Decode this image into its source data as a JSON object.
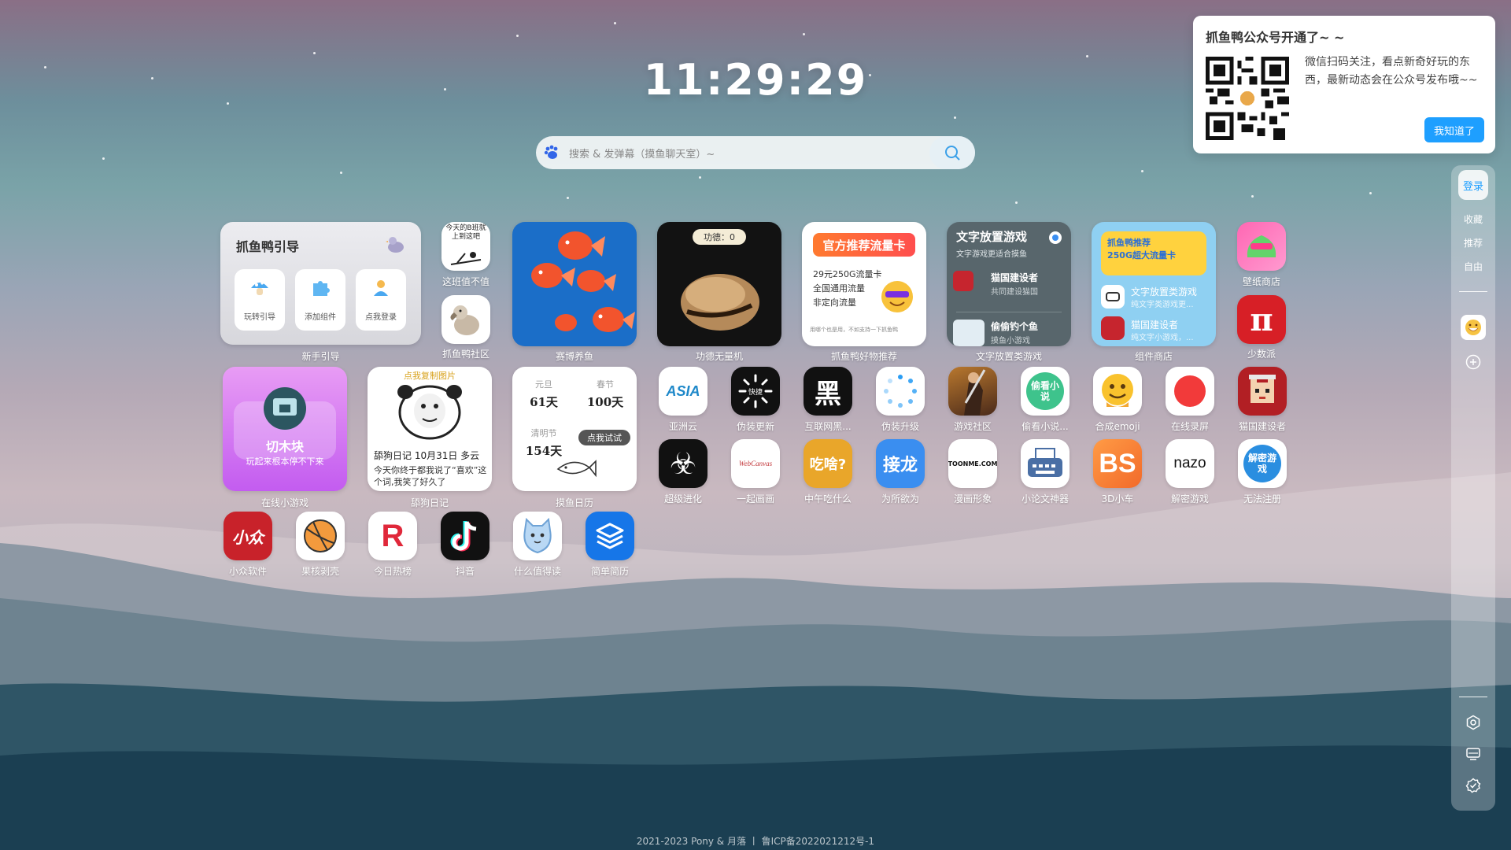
{
  "clock": {
    "time": "11:29:29"
  },
  "search": {
    "placeholder": "搜索 & 发弹幕（摸鱼聊天室）~"
  },
  "notice": {
    "title": "抓鱼鸭公众号开通了~ ~",
    "desc": "微信扫码关注，看点新奇好玩的东西，最新动态会在公众号发布哦~~",
    "button": "我知道了"
  },
  "dock": {
    "login": "登录",
    "items": [
      "收藏",
      "推荐",
      "自由"
    ]
  },
  "guide": {
    "title": "抓鱼鸭引导",
    "buttons": [
      "玩转引导",
      "添加组件",
      "点我登录"
    ],
    "label": "新手引导"
  },
  "small_tiles": {
    "bili_text": "今天的B班就上到这吧",
    "bili_label": "这班值不值",
    "dodo_label": "抓鱼鸭社区"
  },
  "fish": {
    "label": "赛博养鱼"
  },
  "merit": {
    "badge": "功德：0",
    "label": "功德无量机"
  },
  "data_card": {
    "title": "官方推荐流量卡",
    "lines": [
      "29元250G流量卡",
      "全国通用流量",
      "非定向流量"
    ],
    "foot": "用哪个也是用，不如支持一下抓鱼鸭",
    "label": "抓鱼鸭好物推荐"
  },
  "text_games": {
    "title": "文字放置游戏",
    "subtitle": "文字游戏更适合摸鱼",
    "items": [
      {
        "name": "猫国建设者",
        "desc": "共同建设猫国"
      },
      {
        "name": "偷偷钓个鱼",
        "desc": "摸鱼小游戏"
      }
    ],
    "label": "文字放置类游戏"
  },
  "widget_shop": {
    "banner_line1": "抓鱼鸭推荐",
    "banner_line2": "250G超大流量卡",
    "items": [
      {
        "name": "文字放置类游戏",
        "desc": "纯文字类游戏更..."
      },
      {
        "name": "猫国建设者",
        "desc": "纯文字小游戏，..."
      }
    ],
    "label": "组件商店"
  },
  "wallpaper": {
    "label": "壁纸商店"
  },
  "pi": {
    "label": "少数派"
  },
  "block": {
    "title": "切木块",
    "desc": "玩起来根本停不下来",
    "label": "在线小游戏"
  },
  "diary": {
    "top": "点我复制图片",
    "head": "舔狗日记 10月31日 多云",
    "body": "今天你终于都我说了“喜欢”这个词,我笑了好久了",
    "label": "舔狗日记"
  },
  "calendar": {
    "items": [
      {
        "name": "元旦",
        "days": "61天"
      },
      {
        "name": "春节",
        "days": "100天"
      },
      {
        "name": "清明节",
        "days": "154天"
      }
    ],
    "try": "点我试试",
    "label": "摸鱼日历"
  },
  "icon_grid": {
    "row1": [
      {
        "label": "亚洲云",
        "text": "ASIA"
      },
      {
        "label": "伪装更新",
        "text": "快捷"
      },
      {
        "label": "互联网黑...",
        "text": "黑"
      },
      {
        "label": "伪装升级",
        "text": ""
      },
      {
        "label": "游戏社区",
        "text": ""
      },
      {
        "label": "偷看小说...",
        "text": "偷看小说"
      },
      {
        "label": "合成emoji",
        "text": ""
      },
      {
        "label": "在线录屏",
        "text": ""
      },
      {
        "label": "猫国建设者",
        "text": ""
      }
    ],
    "row2": [
      {
        "label": "超级进化",
        "text": "☣"
      },
      {
        "label": "一起画画",
        "text": "WebCanvas"
      },
      {
        "label": "中午吃什么",
        "text": "吃啥?"
      },
      {
        "label": "为所欲为",
        "text": "接龙"
      },
      {
        "label": "漫画形象",
        "text": "TOONME.COM"
      },
      {
        "label": "小论文神器",
        "text": ""
      },
      {
        "label": "3D小车",
        "text": "BS"
      },
      {
        "label": "解密游戏",
        "text": "nazo"
      },
      {
        "label": "无法注册",
        "text": "解密游戏"
      }
    ],
    "row3": [
      {
        "label": "小众软件",
        "text": "小众"
      },
      {
        "label": "果核剥壳",
        "text": ""
      },
      {
        "label": "今日热榜",
        "text": "R"
      },
      {
        "label": "抖音",
        "text": ""
      },
      {
        "label": "什么值得读",
        "text": ""
      },
      {
        "label": "简单简历",
        "text": ""
      }
    ]
  },
  "footer": {
    "text": "2021-2023 Pony & 月落  丨  鲁ICP备2022021212号-1"
  }
}
